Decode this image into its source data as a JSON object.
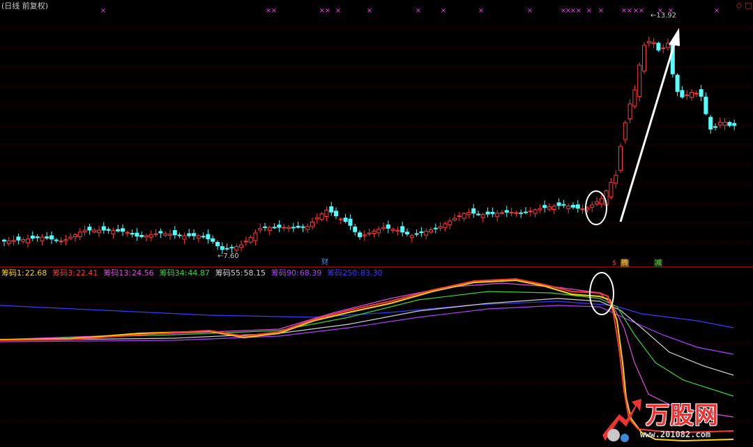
{
  "window": {
    "title": "(日线 前复权)",
    "corner_icons": [
      "◇",
      "□"
    ]
  },
  "price_pane": {
    "high_label": "13.92",
    "low_label": "7.60",
    "marker_char": "×",
    "badges": [
      {
        "text": "财",
        "color": "#4a90e2",
        "bg": "transparent"
      },
      {
        "text": "$",
        "color": "#ff3030",
        "bg": "transparent"
      },
      {
        "text": "腾",
        "color": "#ffd070",
        "bg": "#7a4a00"
      },
      {
        "text": "减",
        "color": "#5ad05a",
        "bg": "#2a3a10"
      }
    ]
  },
  "indicator": {
    "items": [
      {
        "label": "筹码1:",
        "value": "22.68",
        "color": "#ffd400"
      },
      {
        "label": "筹码3:",
        "value": "22.41",
        "color": "#ff3b3b"
      },
      {
        "label": "筹码13:",
        "value": "24.56",
        "color": "#e04ce0"
      },
      {
        "label": "筹码34:",
        "value": "44.87",
        "color": "#39d739"
      },
      {
        "label": "筹码55:",
        "value": "58.15",
        "color": "#d0d0d0"
      },
      {
        "label": "筹码90:",
        "value": "68.39",
        "color": "#b040ff"
      },
      {
        "label": "筹码250:",
        "value": "83.30",
        "color": "#3a3aff"
      }
    ]
  },
  "watermark": {
    "name": "万股网",
    "url": "www.201082.com"
  },
  "colors": {
    "up": "#ff3b3b",
    "down": "#54ffff",
    "grid": "#5a0000",
    "separator": "#b00000",
    "marker": "#ff3cff",
    "annotation": "#ffffff"
  }
}
